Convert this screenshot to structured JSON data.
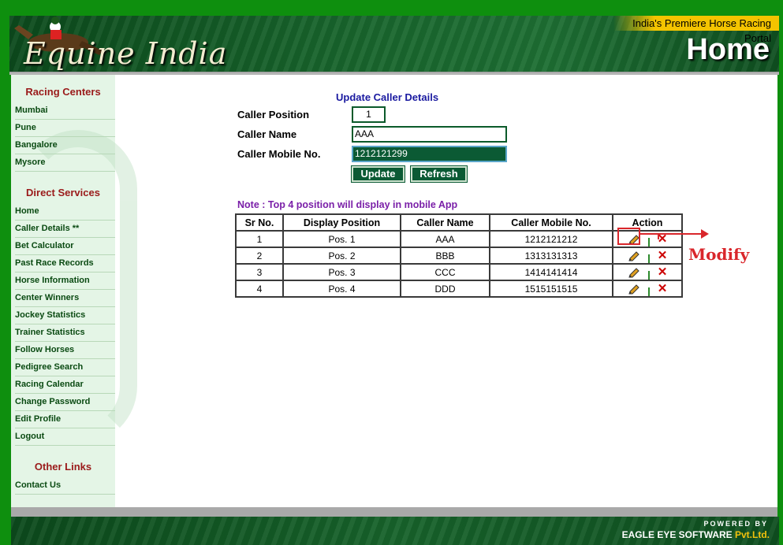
{
  "header": {
    "tagline": "India's Premiere Horse Racing Portal",
    "logo_text": "Equine India",
    "page_heading": "Home"
  },
  "sidebar": {
    "racing_centers_heading": "Racing Centers",
    "racing_centers": [
      "Mumbai",
      "Pune",
      "Bangalore",
      "Mysore"
    ],
    "direct_services_heading": "Direct Services",
    "direct_services": [
      "Home",
      "Caller Details **",
      "Bet Calculator",
      "Past Race Records",
      "Horse Information",
      "Center Winners",
      "Jockey Statistics",
      "Trainer Statistics",
      "Follow Horses",
      "Pedigree Search",
      "Racing Calendar",
      "Change Password",
      "Edit Profile",
      "Logout"
    ],
    "other_links_heading": "Other Links",
    "other_links": [
      "Contact Us"
    ]
  },
  "form": {
    "title": "Update Caller Details",
    "caller_position_label": "Caller Position",
    "caller_position_value": "1",
    "caller_name_label": "Caller Name",
    "caller_name_value": "AAA",
    "caller_mobile_label": "Caller Mobile No.",
    "caller_mobile_value": "1212121299",
    "update_label": "Update",
    "refresh_label": "Refresh"
  },
  "note": "Note : Top 4 position will display in mobile App",
  "table": {
    "headers": [
      "Sr No.",
      "Display Position",
      "Caller Name",
      "Caller Mobile No.",
      "Action"
    ],
    "rows": [
      [
        "1",
        "Pos. 1",
        "AAA",
        "1212121212"
      ],
      [
        "2",
        "Pos. 2",
        "BBB",
        "1313131313"
      ],
      [
        "3",
        "Pos. 3",
        "CCC",
        "1414141414"
      ],
      [
        "4",
        "Pos. 4",
        "DDD",
        "1515151515"
      ]
    ]
  },
  "annotation": {
    "label": "Modify",
    "color": "#d9262b"
  },
  "footer": {
    "powered_by": "POWERED BY",
    "company": "EAGLE EYE SOFTWARE",
    "company_suffix": "Pvt.Ltd."
  },
  "colors": {
    "frame": "#0e8f0e",
    "header_dark": "#0c4a1c",
    "button": "#0b5a34",
    "sidebar_bg": "#e4f5e6",
    "heading_red": "#9a1a1a"
  },
  "icons": [
    "horse-jockey-icon",
    "pencil-icon",
    "delete-x-icon",
    "arrow-right-icon"
  ]
}
